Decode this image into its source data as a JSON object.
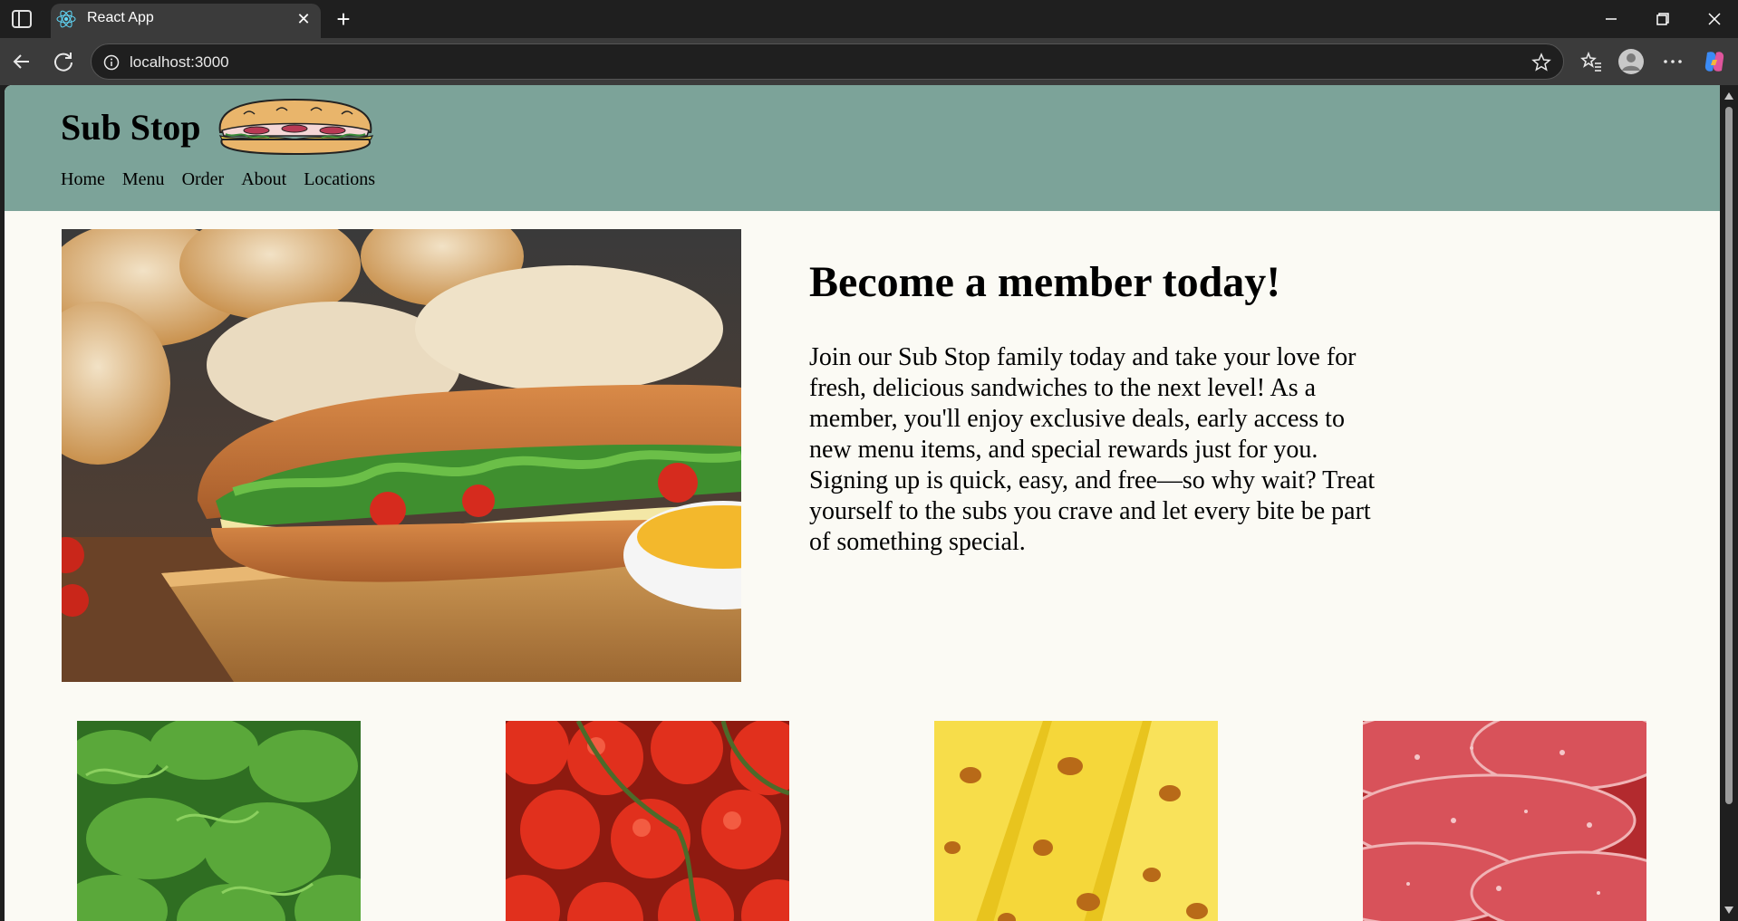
{
  "browser": {
    "tab_title": "React App",
    "url": "localhost:3000",
    "new_tab_glyph": "+",
    "close_glyph": "✕",
    "icons": [
      "sidebar-toggle-icon",
      "react-favicon",
      "close-icon",
      "new-tab-icon",
      "minimize-icon",
      "maximize-icon",
      "window-close-icon",
      "back-icon",
      "reload-icon",
      "info-icon",
      "star-icon",
      "favorites-icon",
      "profile-icon",
      "more-icon",
      "copilot-icon"
    ]
  },
  "site": {
    "title": "Sub Stop",
    "nav": [
      "Home",
      "Menu",
      "Order",
      "About",
      "Locations"
    ],
    "header_color": "#7ca399",
    "background_color": "#fbfaf4"
  },
  "hero": {
    "title": "Become a member today!",
    "text": "Join our Sub Stop family today and take your love for fresh, delicious sandwiches to the next level! As a member, you'll enjoy exclusive deals, early access to new menu items, and special rewards just for you. Signing up is quick, easy, and free—so why wait? Treat yourself to the subs you crave and let every bite be part of something special."
  },
  "ingredients": [
    "lettuce",
    "tomatoes",
    "cheese",
    "salami"
  ]
}
